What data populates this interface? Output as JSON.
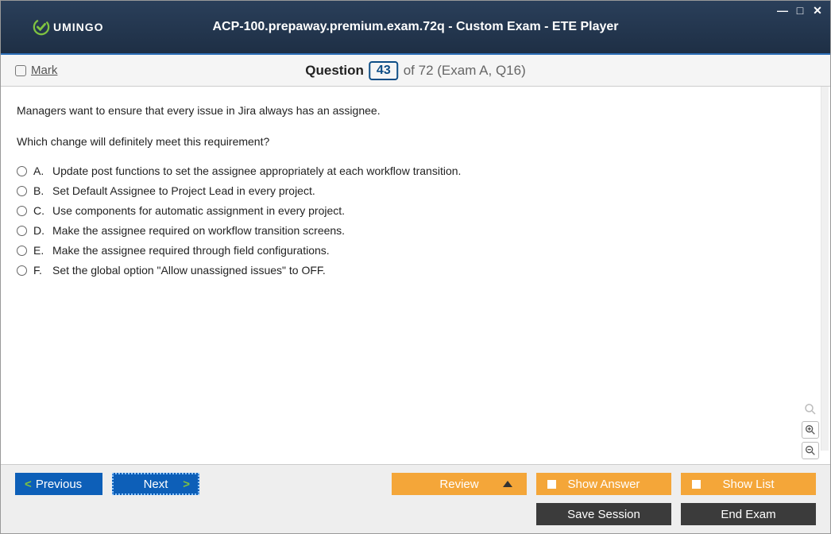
{
  "titlebar": {
    "brand": "UMINGO",
    "title": "ACP-100.prepaway.premium.exam.72q - Custom Exam - ETE Player"
  },
  "header": {
    "mark_label": "Mark",
    "question_label": "Question",
    "question_number": "43",
    "question_total": "of 72 (Exam A, Q16)"
  },
  "question": {
    "line1": "Managers want to ensure that every issue in Jira always has an assignee.",
    "line2": "Which change will definitely meet this requirement?"
  },
  "answers": [
    {
      "letter": "A.",
      "text": "Update post functions to set the assignee appropriately at each workflow transition."
    },
    {
      "letter": "B.",
      "text": "Set Default Assignee to Project Lead in every project."
    },
    {
      "letter": "C.",
      "text": "Use components for automatic assignment in every project."
    },
    {
      "letter": "D.",
      "text": "Make the assignee required on workflow transition screens."
    },
    {
      "letter": "E.",
      "text": "Make the assignee required through field configurations."
    },
    {
      "letter": "F.",
      "text": "Set the global option \"Allow unassigned issues\" to OFF."
    }
  ],
  "footer": {
    "previous": "Previous",
    "next": "Next",
    "review": "Review",
    "show_answer": "Show Answer",
    "show_list": "Show List",
    "save_session": "Save Session",
    "end_exam": "End Exam"
  }
}
